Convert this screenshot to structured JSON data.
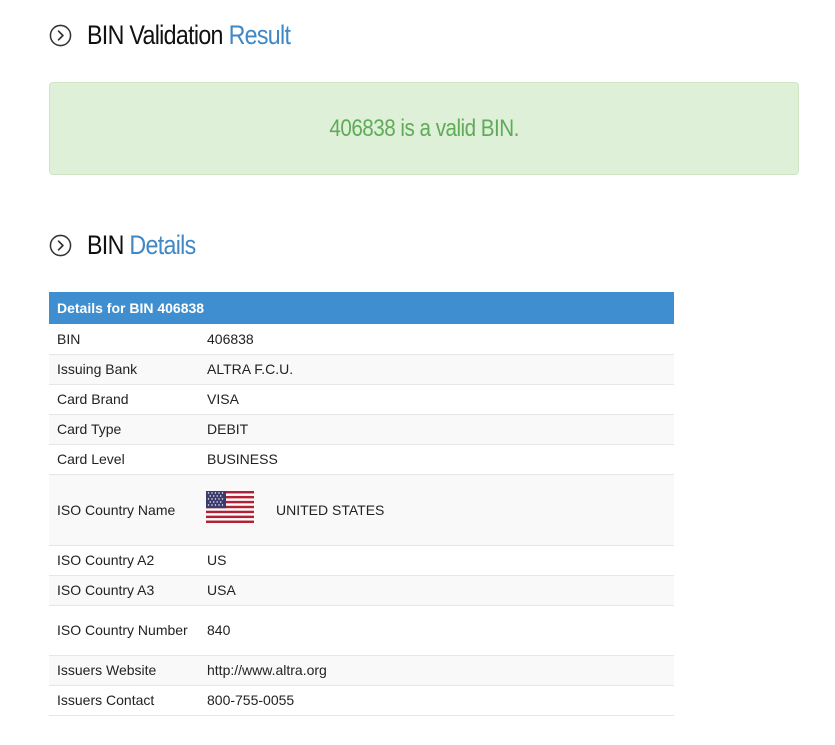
{
  "validation_heading": {
    "part1": "BIN Validation",
    "part2": "Result",
    "icon": "chevron-right-circle-icon"
  },
  "alert": {
    "text": "406838 is a valid BIN."
  },
  "details_heading": {
    "part1": "BIN",
    "part2": "Details",
    "icon": "chevron-right-circle-icon"
  },
  "details_table": {
    "header": "Details for BIN 406838",
    "rows": [
      {
        "label": "BIN",
        "value": "406838"
      },
      {
        "label": "Issuing Bank",
        "value": "ALTRA F.C.U."
      },
      {
        "label": "Card Brand",
        "value": "VISA"
      },
      {
        "label": "Card Type",
        "value": "DEBIT"
      },
      {
        "label": "Card Level",
        "value": "BUSINESS"
      },
      {
        "label": "ISO Country Name",
        "value": "UNITED STATES",
        "icon": "us-flag-icon"
      },
      {
        "label": "ISO Country A2",
        "value": "US"
      },
      {
        "label": "ISO Country A3",
        "value": "USA"
      },
      {
        "label": "ISO Country Number",
        "value": "840"
      },
      {
        "label": "Issuers Website",
        "value": "http://www.altra.org"
      },
      {
        "label": "Issuers Contact",
        "value": "800-755-0055"
      }
    ]
  },
  "colors": {
    "accent_blue": "#3f88c5",
    "table_header_bg": "#3f8fd0",
    "alert_bg": "#dff0d8",
    "alert_text": "#5fab58"
  }
}
